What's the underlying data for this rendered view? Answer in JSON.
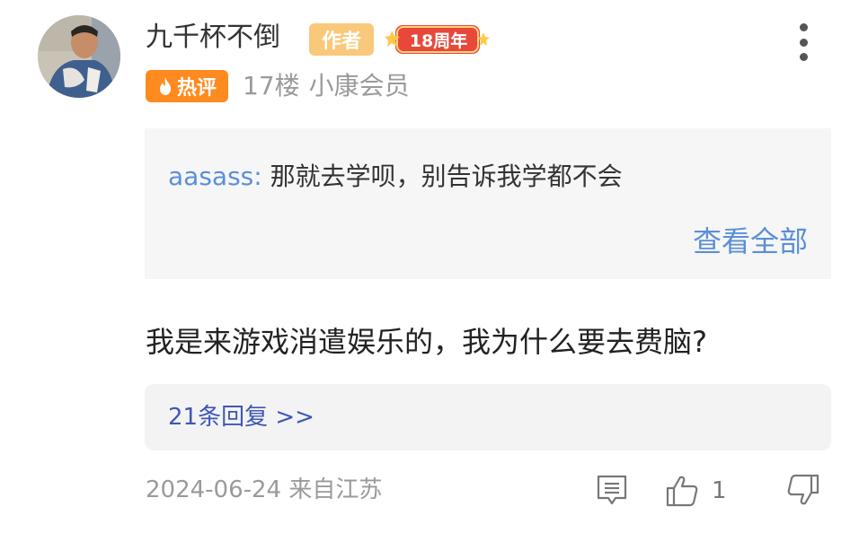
{
  "author": {
    "name": "九千杯不倒",
    "author_badge": "作者",
    "anniversary_badge": "18周年"
  },
  "meta": {
    "hot_badge": "热评",
    "floor": "17楼",
    "membership": "小康会员"
  },
  "quote": {
    "user": "aasass:",
    "text": " 那就去学呗，别告诉我学都不会",
    "view_all": "查看全部"
  },
  "comment": {
    "body": "我是来游戏消遣娱乐的，我为什么要去费脑?"
  },
  "replies": {
    "link": "21条回复 >>"
  },
  "footer": {
    "date_location": "2024-06-24 来自江苏",
    "like_count": "1"
  },
  "colors": {
    "accent_link": "#5a8fd8",
    "reply_link": "#3f57b5",
    "hot_orange": "#ff8a1f",
    "author_badge": "#f9c87a",
    "anniversary_red": "#e8483a"
  },
  "icons": {
    "menu": "more-vertical-icon",
    "hot": "flame-icon",
    "reply": "comment-icon",
    "like": "thumbs-up-icon",
    "dislike": "thumbs-down-icon"
  }
}
